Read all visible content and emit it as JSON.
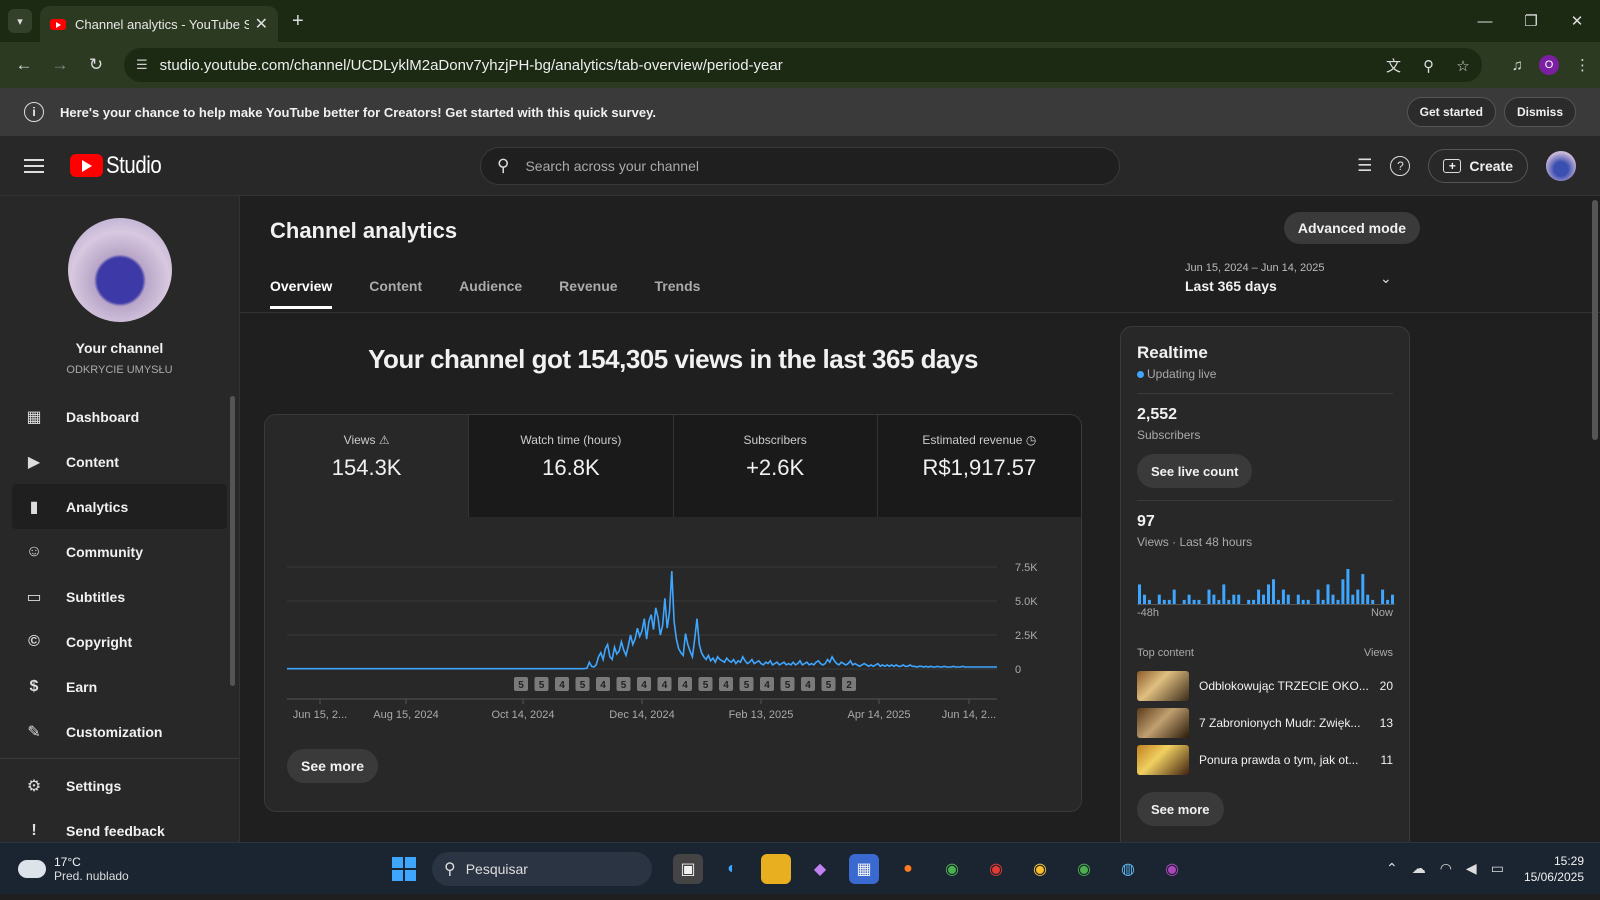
{
  "browser": {
    "tab_title": "Channel analytics - YouTube Stu",
    "url": "studio.youtube.com/channel/UCDLyklM2aDonv7yhzjPH-bg/analytics/tab-overview/period-year"
  },
  "survey": {
    "text": "Here's your chance to help make YouTube better for Creators! Get started with this quick survey.",
    "get_started": "Get started",
    "dismiss": "Dismiss"
  },
  "header": {
    "logo_text": "Studio",
    "search_placeholder": "Search across your channel",
    "create_label": "Create"
  },
  "sidebar": {
    "channel_title": "Your channel",
    "channel_name": "ODKRYCIE UMYSŁU",
    "items": [
      {
        "label": "Dashboard",
        "icon": "dashboard-icon"
      },
      {
        "label": "Content",
        "icon": "content-icon"
      },
      {
        "label": "Analytics",
        "icon": "analytics-icon",
        "active": true
      },
      {
        "label": "Community",
        "icon": "community-icon"
      },
      {
        "label": "Subtitles",
        "icon": "subtitles-icon"
      },
      {
        "label": "Copyright",
        "icon": "copyright-icon"
      },
      {
        "label": "Earn",
        "icon": "earn-icon"
      },
      {
        "label": "Customization",
        "icon": "customization-icon"
      }
    ],
    "bottom_items": [
      {
        "label": "Settings",
        "icon": "gear-icon"
      },
      {
        "label": "Send feedback",
        "icon": "feedback-icon"
      }
    ]
  },
  "main": {
    "title": "Channel analytics",
    "advanced_mode": "Advanced mode",
    "tabs": [
      "Overview",
      "Content",
      "Audience",
      "Revenue",
      "Trends"
    ],
    "date_range": "Jun 15, 2024 – Jun 14, 2025",
    "date_label": "Last 365 days",
    "headline": "Your channel got 154,305 views in the last 365 days",
    "metrics": [
      {
        "label": "Views",
        "value": "154.3K"
      },
      {
        "label": "Watch time (hours)",
        "value": "16.8K"
      },
      {
        "label": "Subscribers",
        "value": "+2.6K"
      },
      {
        "label": "Estimated revenue",
        "value": "R$1,917.57"
      }
    ],
    "see_more": "See more"
  },
  "chart_data": {
    "type": "line",
    "series": [
      {
        "name": "Views",
        "color": "#3ea6ff"
      }
    ],
    "x_tick_labels": [
      "Jun 15, 2...",
      "Aug 15, 2024",
      "Oct 14, 2024",
      "Dec 14, 2024",
      "Feb 13, 2025",
      "Apr 14, 2025",
      "Jun 14, 2..."
    ],
    "y_tick_labels": [
      "7.5K",
      "5.0K",
      "2.5K",
      "0"
    ],
    "ylim": [
      0,
      7500
    ],
    "values_note_points": [
      0,
      0,
      0,
      0,
      0,
      0,
      0,
      0,
      0,
      0,
      0,
      0,
      0,
      0,
      0,
      0,
      0,
      0,
      0,
      0,
      0,
      0,
      0,
      0,
      0,
      0,
      0,
      0,
      0,
      0,
      0,
      0,
      0,
      0,
      0,
      0,
      0,
      0,
      0,
      0,
      0,
      0,
      0,
      0,
      0,
      0,
      0,
      0,
      0,
      0,
      0,
      0,
      0,
      0,
      0,
      0,
      0,
      0,
      0,
      0,
      0,
      0,
      0,
      0,
      0,
      0,
      0,
      0,
      0,
      0,
      0,
      0,
      0,
      0,
      0,
      0,
      0,
      0,
      0,
      0,
      0,
      0,
      0,
      0,
      0,
      0,
      0,
      0,
      0,
      0,
      0,
      0,
      0,
      0,
      0,
      0,
      0,
      0,
      0,
      0,
      0,
      0,
      0,
      0,
      0,
      0,
      0,
      0,
      0,
      0,
      0,
      0,
      0,
      0,
      0,
      0,
      0,
      0,
      0,
      0,
      0,
      0,
      0,
      0,
      0,
      0,
      0,
      0,
      0,
      0,
      0,
      0,
      0,
      0,
      0,
      0,
      0,
      0,
      0,
      0,
      0,
      0,
      0,
      0,
      0,
      0,
      0,
      0,
      0,
      0,
      0,
      0,
      0,
      0,
      0,
      0,
      0,
      0,
      0,
      0,
      0,
      0,
      0,
      0,
      0,
      0,
      0,
      0,
      0,
      0,
      0,
      0,
      0,
      0,
      0,
      0,
      0,
      0,
      0,
      0,
      0,
      0,
      0,
      0,
      0,
      0,
      0,
      0,
      0,
      0,
      0,
      0,
      0,
      0,
      0,
      0,
      0,
      0,
      0,
      0,
      0,
      0,
      0,
      0,
      0,
      0,
      0,
      0,
      0,
      0,
      0,
      0,
      0,
      0,
      0,
      0,
      0,
      0,
      0,
      0,
      0,
      0,
      0,
      0,
      0,
      0,
      0,
      0,
      0,
      0,
      0,
      0,
      0,
      0,
      0,
      0,
      0,
      0,
      0,
      0,
      0,
      0,
      0,
      0,
      0,
      0,
      0,
      0,
      0,
      0,
      0,
      0,
      0,
      0,
      0,
      0,
      0,
      0,
      0,
      0,
      0,
      0,
      0,
      0,
      0,
      0,
      0,
      0,
      0,
      0,
      0,
      0,
      0,
      0,
      0,
      0,
      0,
      0,
      0,
      0,
      0,
      0,
      0,
      0,
      0,
      0,
      0,
      0,
      0,
      0,
      0,
      0,
      0,
      0,
      0,
      0,
      0,
      0,
      0,
      0,
      0,
      0,
      0,
      0,
      0,
      0,
      0,
      0,
      0,
      0,
      0,
      0,
      0,
      0,
      0,
      0,
      0,
      0,
      0,
      0,
      0,
      0,
      0,
      0,
      0,
      0,
      0,
      0,
      0,
      0,
      0,
      0,
      0,
      0,
      0,
      0,
      0,
      0,
      0,
      0,
      0,
      0,
      0,
      0,
      0,
      0,
      0,
      0,
      0,
      0,
      0,
      0,
      0,
      0,
      0,
      0,
      0,
      0,
      0
    ],
    "values": [
      20,
      20,
      20,
      20,
      20,
      20,
      20,
      20,
      20,
      20,
      20,
      20,
      20,
      20,
      20,
      20,
      20,
      20,
      20,
      20,
      20,
      20,
      20,
      20,
      20,
      20,
      20,
      20,
      20,
      20,
      20,
      20,
      20,
      20,
      20,
      20,
      20,
      20,
      20,
      20,
      20,
      20,
      20,
      20,
      20,
      20,
      20,
      20,
      20,
      20,
      20,
      20,
      20,
      20,
      20,
      20,
      20,
      20,
      20,
      20,
      20,
      20,
      20,
      20,
      20,
      20,
      20,
      20,
      20,
      20,
      20,
      20,
      20,
      20,
      20,
      20,
      20,
      20,
      20,
      20,
      20,
      20,
      20,
      20,
      20,
      20,
      20,
      20,
      20,
      20,
      20,
      20,
      20,
      20,
      20,
      20,
      20,
      20,
      20,
      20,
      20,
      20,
      20,
      20,
      20,
      20,
      20,
      20,
      20,
      20,
      20,
      20,
      20,
      20,
      20,
      20,
      20,
      20,
      20,
      20,
      20,
      20,
      20,
      20,
      20,
      20,
      20,
      20,
      20,
      20,
      30,
      60,
      500,
      200,
      150,
      300,
      900,
      1200,
      700,
      1500,
      1800,
      900,
      700,
      1600,
      1100,
      1300,
      2000,
      1400,
      1000,
      1700,
      2500,
      1800,
      2200,
      3000,
      2400,
      2800,
      3700,
      2200,
      3500,
      4000,
      2900,
      4500,
      3800,
      2500,
      3200,
      5200,
      3000,
      4200,
      7200,
      3500,
      2200,
      1500,
      1200,
      1000,
      2600,
      1800,
      1300,
      900,
      2200,
      3700,
      1800,
      1200,
      900,
      700,
      1000,
      600,
      800,
      500,
      900,
      700,
      600,
      500,
      800,
      600,
      500,
      700,
      400,
      600,
      500,
      900,
      600,
      400,
      500,
      700,
      400,
      500,
      600,
      400,
      300,
      500,
      400,
      600,
      300,
      400,
      500,
      300,
      400,
      500,
      300,
      400,
      300,
      500,
      300,
      400,
      600,
      300,
      400,
      500,
      300,
      400,
      300,
      500,
      600,
      400,
      300,
      400,
      700,
      500,
      900,
      600,
      400,
      300,
      500,
      400,
      300,
      400,
      600,
      300,
      400,
      300,
      200,
      300,
      400,
      300,
      200,
      300,
      200,
      300,
      400,
      200,
      300,
      200,
      300,
      200,
      300,
      200,
      300,
      200,
      200,
      300,
      200,
      200,
      300,
      200,
      200,
      150,
      200,
      200,
      150,
      200,
      150,
      200,
      150,
      150,
      200,
      150,
      150,
      200,
      150,
      150,
      150,
      200,
      150,
      150,
      150,
      200,
      150,
      150,
      150,
      150,
      150,
      150,
      150,
      150,
      150,
      150,
      150,
      150,
      150,
      150,
      150
    ],
    "upload_markers": [
      "5",
      "5",
      "4",
      "5",
      "4",
      "5",
      "4",
      "4",
      "4",
      "5",
      "4",
      "5",
      "4",
      "5",
      "4",
      "5",
      "2"
    ]
  },
  "realtime": {
    "title": "Realtime",
    "status": "Updating live",
    "subscribers_count": "2,552",
    "subscribers_label": "Subscribers",
    "live_count_btn": "See live count",
    "views_count": "97",
    "views_label": "Views · Last 48 hours",
    "axis_start": "-48h",
    "axis_end": "Now",
    "hourly_views": [
      4,
      2,
      1,
      0,
      2,
      1,
      1,
      3,
      0,
      1,
      2,
      1,
      1,
      0,
      3,
      2,
      1,
      4,
      1,
      2,
      2,
      0,
      1,
      1,
      3,
      2,
      4,
      5,
      1,
      3,
      2,
      0,
      2,
      1,
      1,
      0,
      3,
      1,
      4,
      2,
      1,
      5,
      7,
      2,
      3,
      6,
      2,
      1,
      0,
      3,
      1,
      2
    ],
    "top_content_label": "Top content",
    "views_col": "Views",
    "top_content": [
      {
        "title": "Odblokowując TRZECIE OKO...",
        "views": "20"
      },
      {
        "title": "7 Zabronionych Mudr: Zwięk...",
        "views": "13"
      },
      {
        "title": "Ponura prawda o tym, jak ot...",
        "views": "11"
      }
    ],
    "see_more": "See more"
  },
  "taskbar": {
    "temp": "17°C",
    "weather": "Pred. nublado",
    "search": "Pesquisar",
    "time": "15:29",
    "date": "15/06/2025"
  }
}
